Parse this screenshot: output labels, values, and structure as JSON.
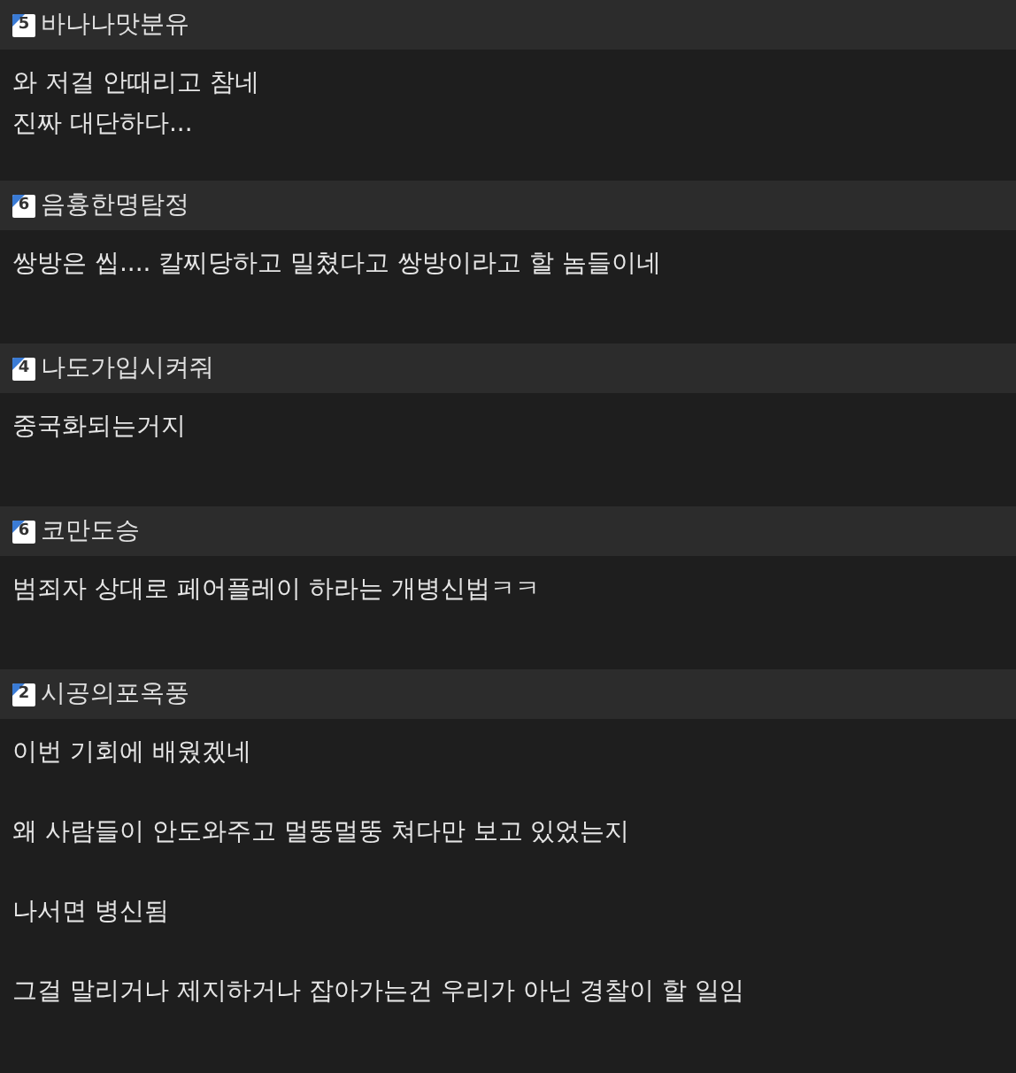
{
  "comments": [
    {
      "level": "5",
      "nickname": "바나나맛분유",
      "paragraphs": [
        "와 저걸 안때리고 참네\n진짜 대단하다..."
      ]
    },
    {
      "level": "6",
      "nickname": "음흉한명탐정",
      "paragraphs": [
        "쌍방은 씹.... 칼찌당하고 밀쳤다고 쌍방이라고 할 놈들이네"
      ]
    },
    {
      "level": "4",
      "nickname": "나도가입시켜줘",
      "paragraphs": [
        "중국화되는거지"
      ]
    },
    {
      "level": "6",
      "nickname": "코만도승",
      "paragraphs": [
        "범죄자 상대로 페어플레이 하라는 개병신법ㅋㅋ"
      ]
    },
    {
      "level": "2",
      "nickname": "시공의포옥풍",
      "paragraphs": [
        "이번 기회에 배웠겠네",
        "왜 사람들이 안도와주고 멀뚱멀뚱 쳐다만 보고 있었는지",
        "나서면 병신됨",
        "그걸 말리거나 제지하거나 잡아가는건 우리가 아닌 경찰이 할 일임"
      ]
    }
  ]
}
